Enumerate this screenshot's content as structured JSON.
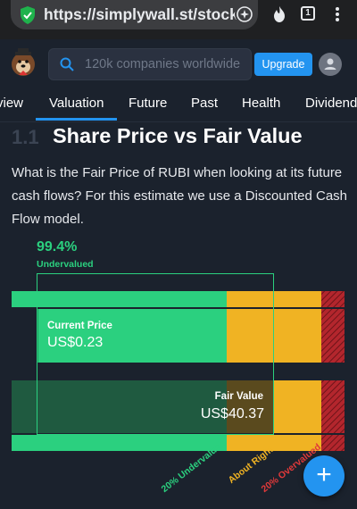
{
  "browser": {
    "url": "https://simplywall.st/stock",
    "tab_count": "1"
  },
  "header": {
    "search_placeholder": "120k companies worldwide",
    "upgrade_label": "Upgrade"
  },
  "tabs": [
    {
      "label": "view"
    },
    {
      "label": "Valuation"
    },
    {
      "label": "Future"
    },
    {
      "label": "Past"
    },
    {
      "label": "Health"
    },
    {
      "label": "Dividend"
    }
  ],
  "section": {
    "number": "1.1",
    "title": "Share Price vs Fair Value",
    "description": "What is the Fair Price of RUBI when looking at its future cash flows? For this estimate we use a Discounted Cash Flow model."
  },
  "valuation": {
    "percent": "99.4%",
    "percent_label": "Undervalued",
    "current_price_label": "Current Price",
    "current_price_value": "US$0.23",
    "fair_value_label": "Fair Value",
    "fair_value_value": "US$40.37",
    "zones": [
      "20% Undervalued",
      "About Right",
      "20% Overvalued"
    ]
  },
  "colors": {
    "undervalued": "#2bd07f",
    "about_right": "#f0b323",
    "overvalued": "#e0393a",
    "accent": "#2394f0"
  }
}
